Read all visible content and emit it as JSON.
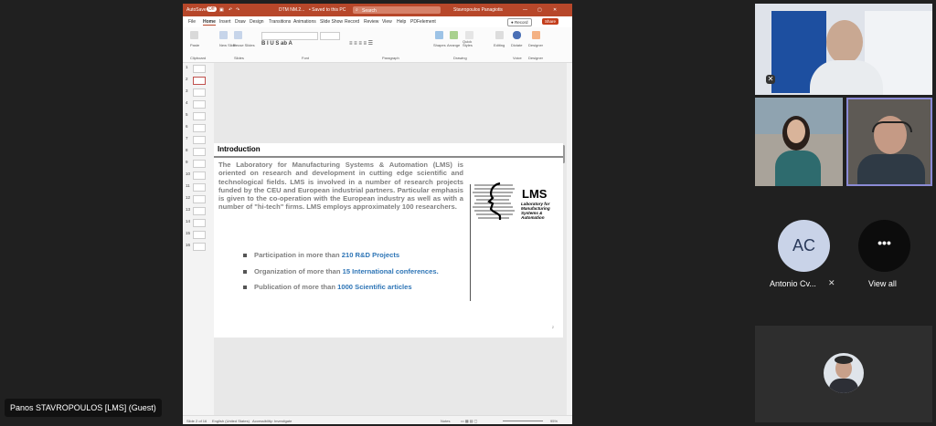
{
  "ppt": {
    "titlebar": {
      "autosave": "AutoSave",
      "toggle": "Off",
      "filename": "DTM NM.2...",
      "saved": "• Saved to this PC",
      "search": "Search",
      "user": "Stavropoulos Panagiotis"
    },
    "menu": [
      "File",
      "Home",
      "Insert",
      "Draw",
      "Design",
      "Transitions",
      "Animations",
      "Slide Show",
      "Record",
      "Review",
      "View",
      "Help",
      "PDFelement"
    ],
    "record_btn": "Record",
    "share_btn": "Share",
    "ribbon_groups": [
      "Clipboard",
      "Slides",
      "Font",
      "Paragraph",
      "Drawing",
      "Voice",
      "Designer"
    ],
    "ribbon_buttons": [
      "Paste",
      "New Slide",
      "Reuse Slides",
      "Shapes",
      "Arrange",
      "Quick Styles",
      "Editing",
      "Dictate",
      "Designer"
    ],
    "slide_numbers": [
      "1",
      "2",
      "3",
      "4",
      "5",
      "6",
      "7",
      "8",
      "9",
      "10",
      "11",
      "12",
      "13",
      "14",
      "15",
      "16"
    ],
    "status": {
      "slide_of": "Slide 2 of 16",
      "language": "English (United States)",
      "accessibility": "Accessibility: Investigate",
      "notes": "Notes",
      "zoom": "95%"
    }
  },
  "slide": {
    "title": "Introduction",
    "intro": "The Laboratory for Manufacturing Systems & Automation (LMS) is oriented on research and development in cutting edge scientific and technological fields. LMS is involved in a number of research projects funded by the CEU and European industrial partners. Particular emphasis is given to the co-operation with the European industry as well as with a number of \"hi-tech\" firms. LMS employs approximately 100 researchers.",
    "bullets": [
      {
        "text": "Participation in more than ",
        "highlight": "210 R&D Projects"
      },
      {
        "text": "Organization of more than ",
        "highlight": "15 International conferences."
      },
      {
        "text": "Publication of more than  ",
        "highlight": "1000 Scientific articles"
      }
    ],
    "logo_title": "LMS",
    "logo_sub": "Laboratory for Manufacturing Systems & Automation",
    "page_number": "2"
  },
  "presenter_label": "Panos STAVROPOULOS [LMS] (Guest)",
  "participants": {
    "ac_initials": "AC",
    "ac_name": "Antonio Cv...",
    "view_all_glyph": "•••",
    "view_all": "View all"
  },
  "colors": {
    "ppt_accent": "#b7472a",
    "highlight_blue": "#2e75b6",
    "active_speaker_border": "#8b8bd6"
  }
}
